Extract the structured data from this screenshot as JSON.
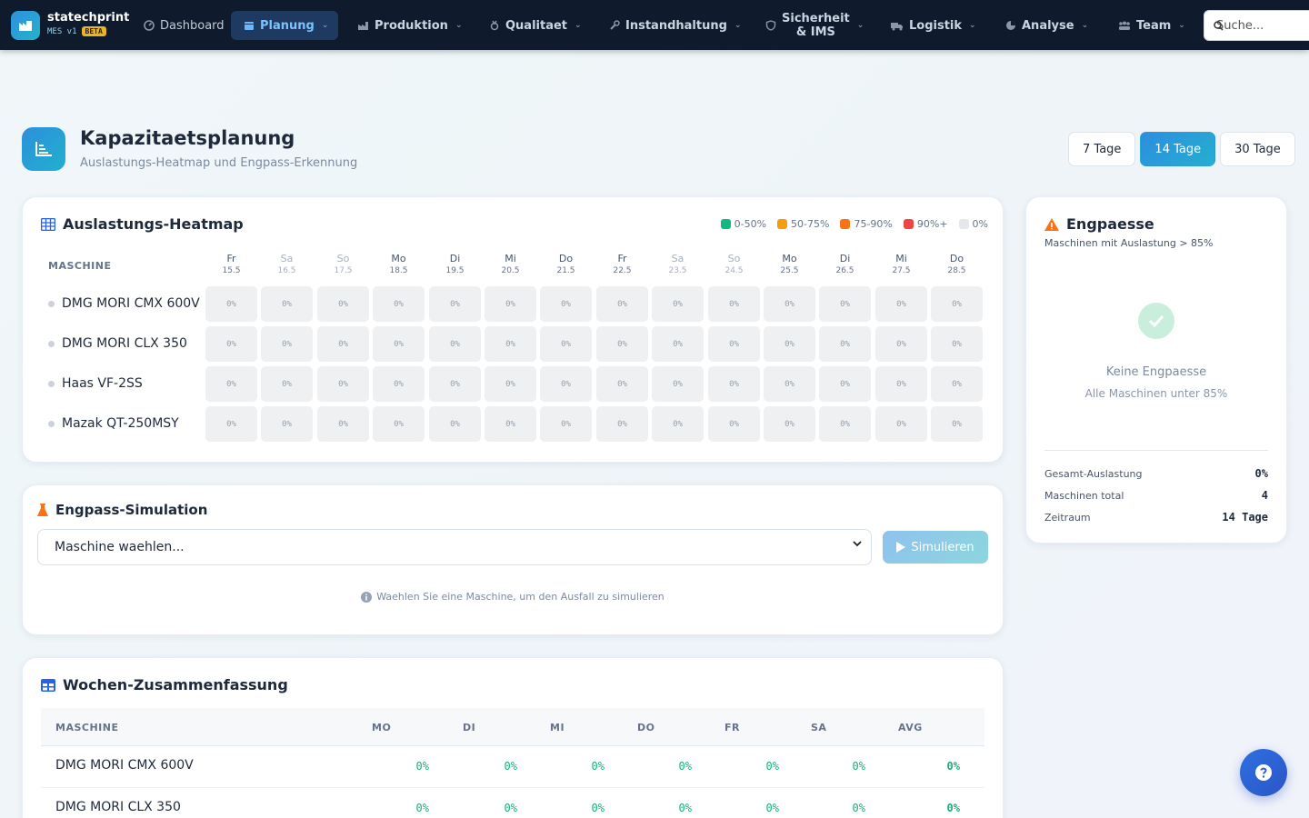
{
  "app": {
    "brand_name": "statechprint",
    "brand_sub": "MES v1",
    "beta": "BETA"
  },
  "nav": {
    "dashboard": "Dashboard",
    "planung": "Planung",
    "produktion": "Produktion",
    "qualitaet": "Qualitaet",
    "instandhaltung": "Instandhaltung",
    "sicherheit_1": "Sicherheit",
    "sicherheit_2": "& IMS",
    "logistik": "Logistik",
    "analyse": "Analyse",
    "team": "Team",
    "search_placeholder": "Suche..."
  },
  "page": {
    "title": "Kapazitaetsplanung",
    "subtitle": "Auslastungs-Heatmap und Engpass-Erkennung",
    "ranges": [
      "7 Tage",
      "14 Tage",
      "30 Tage"
    ],
    "active_range": "14 Tage"
  },
  "heatmap": {
    "title": "Auslastungs-Heatmap",
    "legend": [
      {
        "label": "0-50%",
        "color": "#10b981"
      },
      {
        "label": "50-75%",
        "color": "#f59e0b"
      },
      {
        "label": "75-90%",
        "color": "#f97316"
      },
      {
        "label": "90%+",
        "color": "#ef4444"
      },
      {
        "label": "0%",
        "color": "#e5e7eb"
      }
    ],
    "machine_header": "MASCHINE",
    "days": [
      {
        "d": "Fr",
        "date": "15.5"
      },
      {
        "d": "Sa",
        "date": "16.5"
      },
      {
        "d": "So",
        "date": "17.5"
      },
      {
        "d": "Mo",
        "date": "18.5"
      },
      {
        "d": "Di",
        "date": "19.5"
      },
      {
        "d": "Mi",
        "date": "20.5"
      },
      {
        "d": "Do",
        "date": "21.5"
      },
      {
        "d": "Fr",
        "date": "22.5"
      },
      {
        "d": "Sa",
        "date": "23.5"
      },
      {
        "d": "So",
        "date": "24.5"
      },
      {
        "d": "Mo",
        "date": "25.5"
      },
      {
        "d": "Di",
        "date": "26.5"
      },
      {
        "d": "Mi",
        "date": "27.5"
      },
      {
        "d": "Do",
        "date": "28.5"
      }
    ],
    "machines": [
      "DMG MORI CMX 600V",
      "DMG MORI CLX 350",
      "Haas VF-2SS",
      "Mazak QT-250MSY"
    ],
    "cell_value": "0%"
  },
  "simulation": {
    "title": "Engpass-Simulation",
    "select_value": "Maschine waehlen...",
    "button": "Simulieren",
    "hint": "Waehlen Sie eine Maschine, um den Ausfall zu simulieren"
  },
  "summary": {
    "title": "Wochen-Zusammenfassung",
    "headers": [
      "MASCHINE",
      "MO",
      "DI",
      "MI",
      "DO",
      "FR",
      "SA",
      "AVG"
    ],
    "rows": [
      {
        "name": "DMG MORI CMX 600V",
        "values": [
          "0%",
          "0%",
          "0%",
          "0%",
          "0%",
          "0%",
          "0%"
        ]
      },
      {
        "name": "DMG MORI CLX 350",
        "values": [
          "0%",
          "0%",
          "0%",
          "0%",
          "0%",
          "0%",
          "0%"
        ]
      }
    ]
  },
  "engpaesse": {
    "title": "Engpaesse",
    "subtitle": "Maschinen mit Auslastung > 85%",
    "empty_title": "Keine Engpaesse",
    "empty_sub": "Alle Maschinen unter 85%",
    "stats": [
      {
        "label": "Gesamt-Auslastung",
        "value": "0%"
      },
      {
        "label": "Maschinen total",
        "value": "4"
      },
      {
        "label": "Zeitraum",
        "value": "14 Tage"
      }
    ]
  }
}
